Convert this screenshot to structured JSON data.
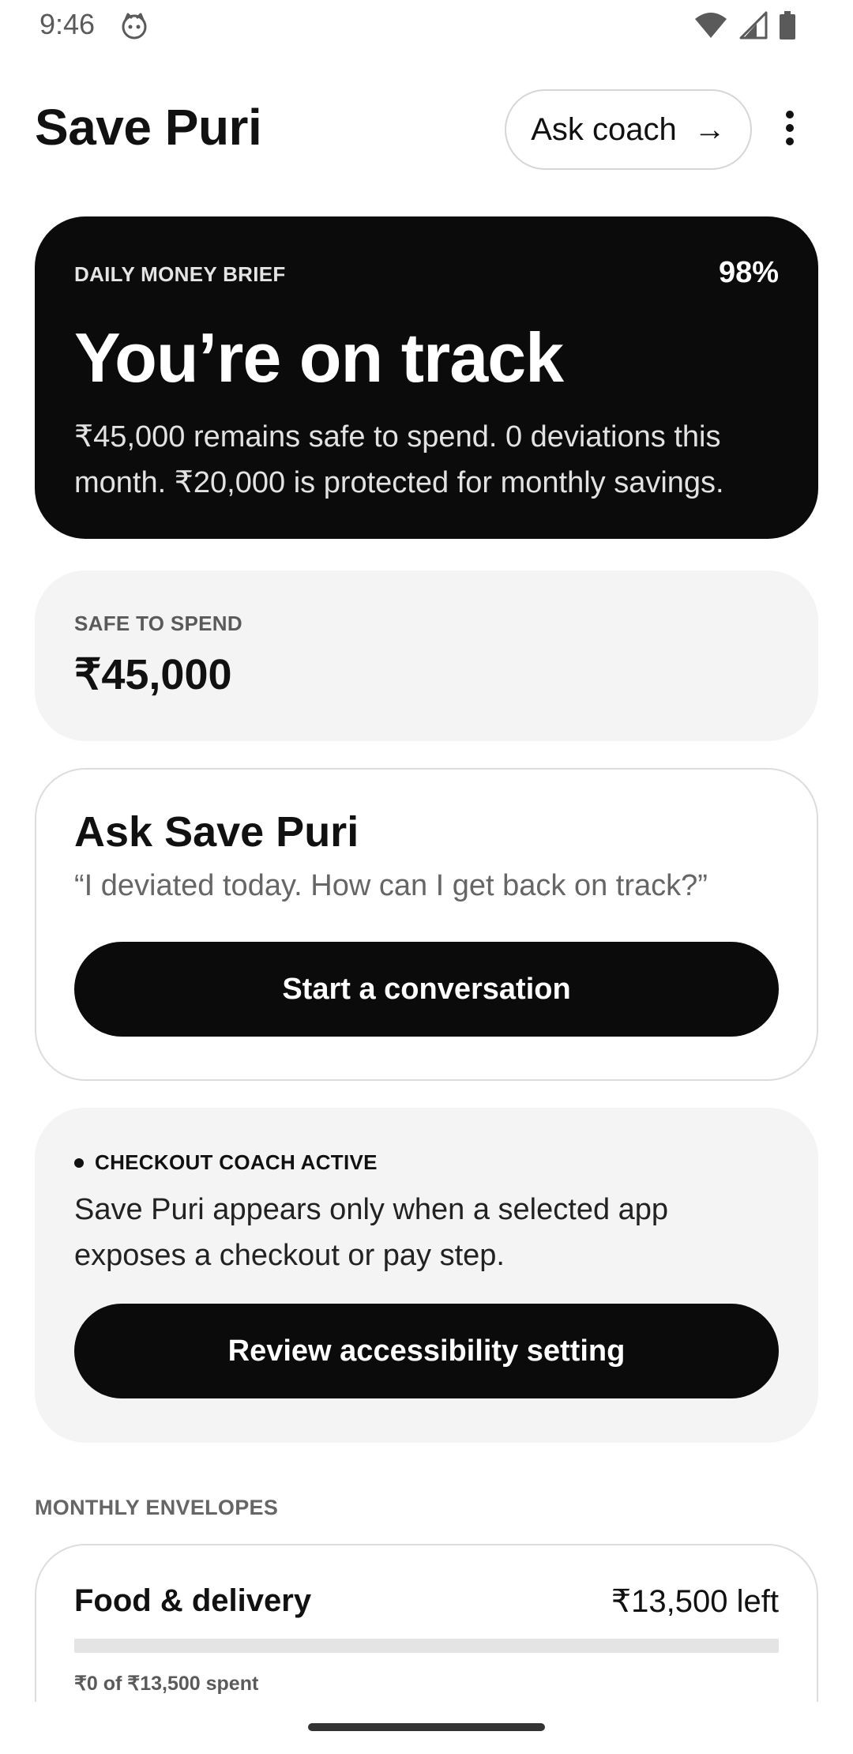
{
  "status_bar": {
    "time": "9:46",
    "app_icon": "cat-face-icon",
    "icons": [
      "wifi-icon",
      "signal-icon",
      "battery-icon"
    ]
  },
  "header": {
    "title": "Save Puri",
    "ask_coach_label": "Ask coach",
    "ask_coach_arrow": "→",
    "menu_icon": "more-vert-icon"
  },
  "brief": {
    "label": "DAILY MONEY BRIEF",
    "percent": "98%",
    "headline": "You’re on track",
    "body": "₹45,000 remains safe to spend. 0 deviations this month. ₹20,000 is protected for monthly savings."
  },
  "safe_to_spend": {
    "label": "SAFE TO SPEND",
    "amount": "₹45,000"
  },
  "ask": {
    "title": "Ask Save Puri",
    "quote": "“I deviated today. How can I get back on track?”",
    "button_label": "Start a conversation"
  },
  "coach": {
    "status": "CHECKOUT COACH ACTIVE",
    "body": "Save Puri appears only when a selected app exposes a checkout or pay step.",
    "button_label": "Review accessibility setting"
  },
  "envelopes": {
    "section_label": "MONTHLY ENVELOPES",
    "items": [
      {
        "name": "Food & delivery",
        "left": "₹13,500 left",
        "spent": "₹0 of ₹13,500 spent",
        "progress": 0
      }
    ]
  },
  "colors": {
    "primary": "#0b0b0b",
    "card_muted": "#f4f4f4",
    "border": "#dcdcdc"
  }
}
